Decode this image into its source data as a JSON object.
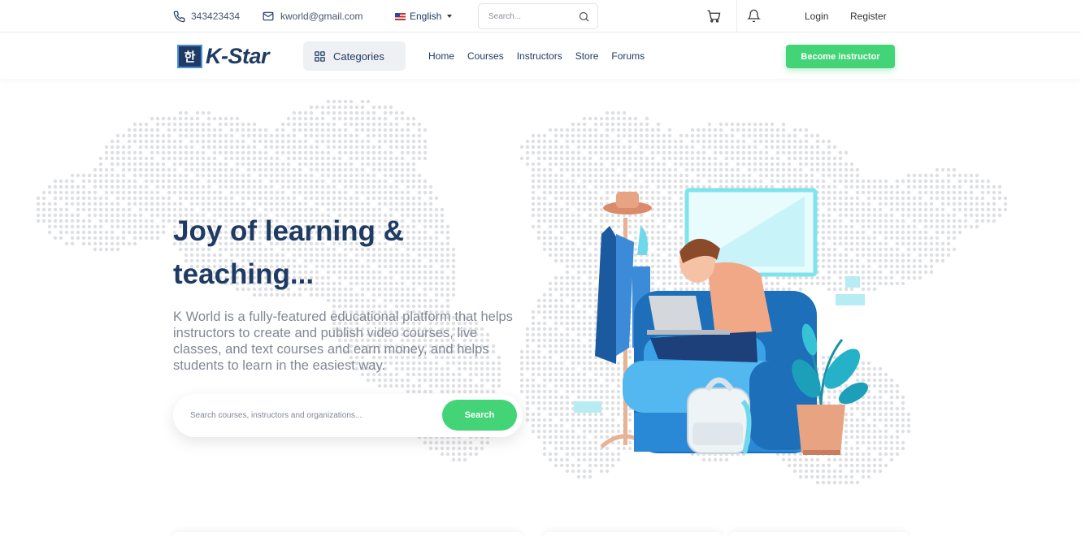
{
  "topbar": {
    "phone": "343423434",
    "email": "kworld@gmail.com",
    "language": "English",
    "search_placeholder": "Search...",
    "login": "Login",
    "register": "Register"
  },
  "navbar": {
    "logo_mark": "한",
    "logo_text": "K-Star",
    "categories_label": "Categories",
    "links": [
      "Home",
      "Courses",
      "Instructors",
      "Store",
      "Forums"
    ],
    "become_instructor": "Become instructor"
  },
  "hero": {
    "title_line1": "Joy of learning &",
    "title_line2": "teaching...",
    "description": "K World is a fully-featured educational platform that helps instructors to create and publish video courses, live classes, and text courses and earn money, and helps students to learn in the easiest way.",
    "search_placeholder": "Search courses, instructors and organizations...",
    "search_button": "Search"
  },
  "colors": {
    "primary": "#1f3b64",
    "accent_green": "#43d477",
    "text_gray": "#818894"
  },
  "icons": {
    "phone": "phone-icon",
    "mail": "mail-icon",
    "flag": "us-flag-icon",
    "search": "search-icon",
    "cart": "cart-icon",
    "bell": "bell-icon",
    "grid": "grid-icon"
  }
}
